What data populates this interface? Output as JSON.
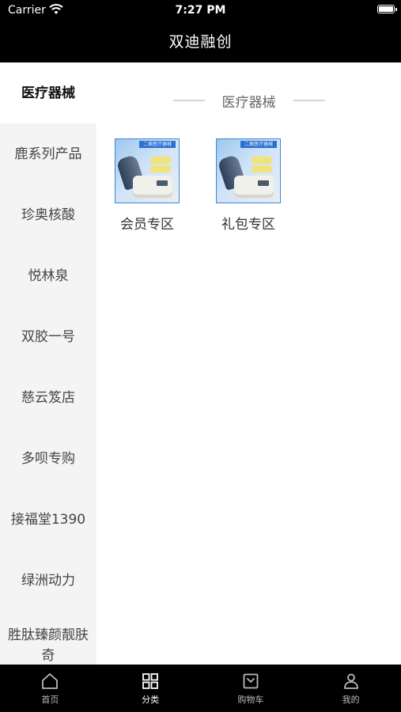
{
  "status_bar": {
    "carrier": "Carrier",
    "time": "7:27 PM"
  },
  "nav": {
    "title": "双迪融创"
  },
  "sidebar": {
    "items": [
      {
        "label": "医疗器械",
        "active": true
      },
      {
        "label": "鹿系列产品"
      },
      {
        "label": "珍奥核酸"
      },
      {
        "label": "悦林泉"
      },
      {
        "label": "双胶一号"
      },
      {
        "label": "慈云笈店"
      },
      {
        "label": "多呗专购"
      },
      {
        "label": "接福堂1390"
      },
      {
        "label": "绿洲动力"
      },
      {
        "label": "胜肽臻颜靓肤奇"
      }
    ]
  },
  "section": {
    "title": "医疗器械"
  },
  "products": [
    {
      "name": "会员专区",
      "image_banner": "二类医疗器械",
      "image_icon": "medical-device-image"
    },
    {
      "name": "礼包专区",
      "image_banner": "二类医疗器械",
      "image_icon": "medical-device-image"
    }
  ],
  "tabbar": {
    "items": [
      {
        "label": "首页",
        "icon": "home-icon"
      },
      {
        "label": "分类",
        "icon": "grid-icon",
        "active": true
      },
      {
        "label": "购物车",
        "icon": "cart-icon"
      },
      {
        "label": "我的",
        "icon": "user-icon"
      }
    ]
  },
  "colors": {
    "bar_bg": "#000000",
    "sidebar_bg": "#f4f4f4",
    "accent_border": "#3a86d6"
  }
}
